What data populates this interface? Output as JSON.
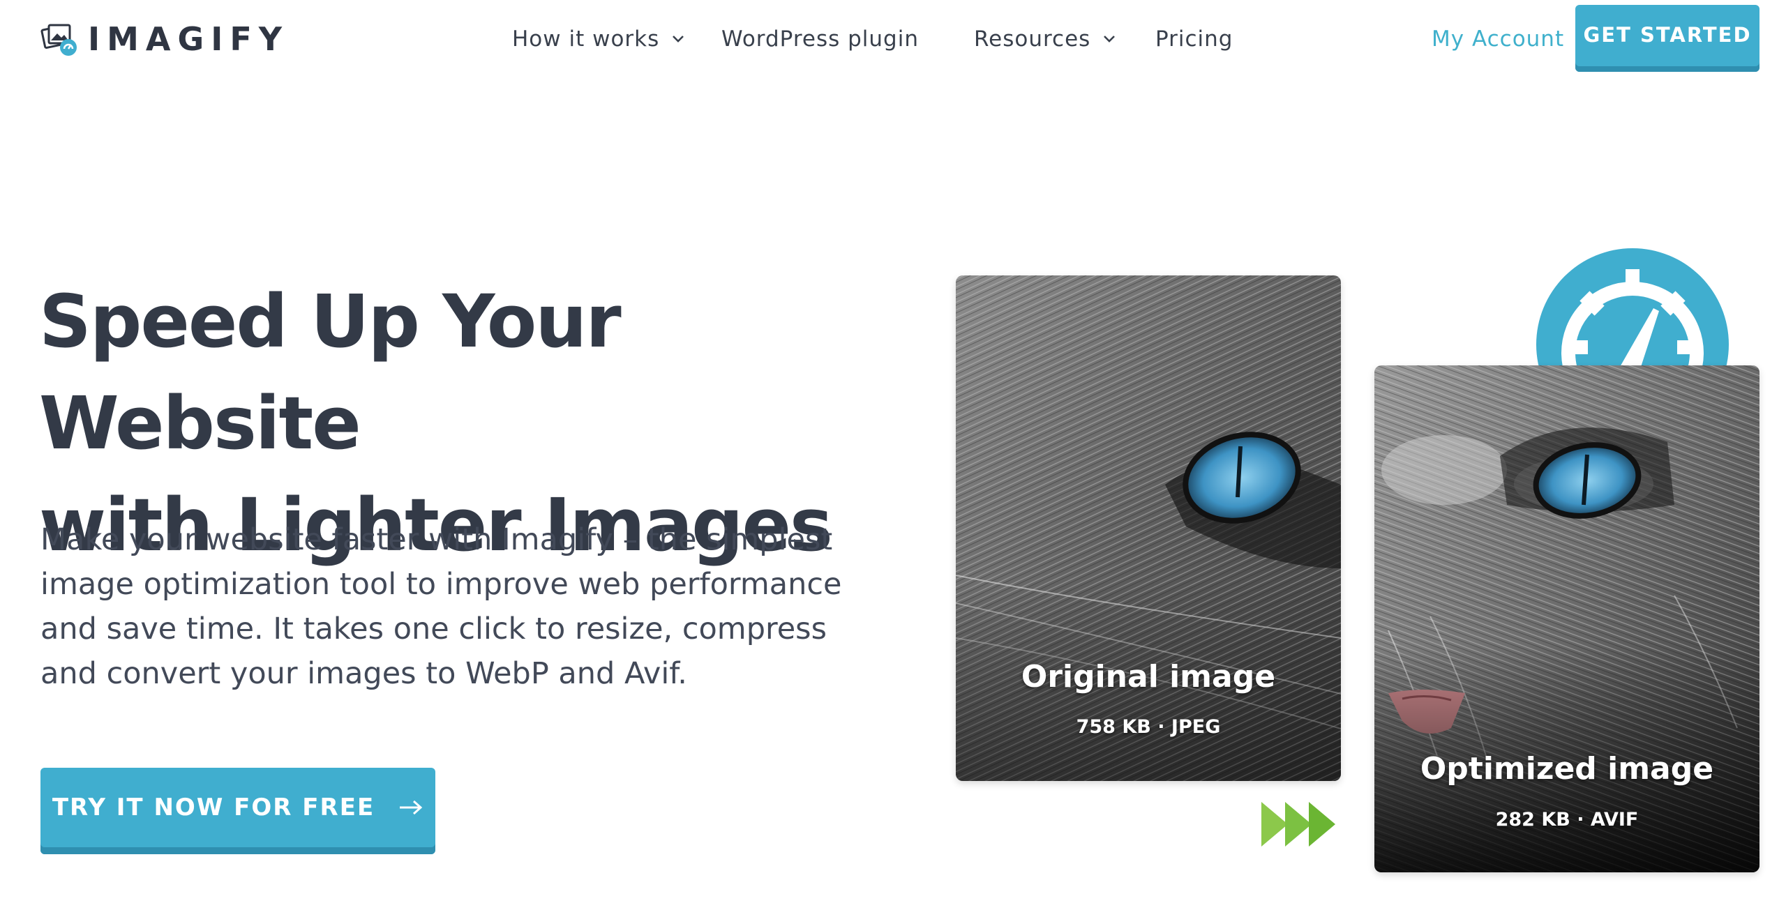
{
  "header": {
    "logo_text": "IMAGIFY",
    "nav": [
      {
        "label": "How it works",
        "has_dropdown": true
      },
      {
        "label": "WordPress plugin",
        "has_dropdown": false
      },
      {
        "label": "Resources",
        "has_dropdown": true
      },
      {
        "label": "Pricing",
        "has_dropdown": false
      }
    ],
    "my_account": "My Account",
    "cta": "GET STARTED"
  },
  "hero": {
    "title_line1": "Speed Up Your Website",
    "title_line2": "with Lighter Images",
    "description": "Make your website faster with Imagify – the simplest image optimization tool to improve web performance and save time. It takes one click to resize, compress and convert your images to WebP and Avif.",
    "cta": "TRY IT NOW FOR FREE"
  },
  "comparison": {
    "original": {
      "title": "Original image",
      "meta": "758 KB · JPEG"
    },
    "optimized": {
      "title": "Optimized image",
      "meta": "282 KB · AVIF"
    }
  },
  "colors": {
    "accent": "#40aecf",
    "text_dark": "#333a47",
    "arrows_green": "#7cc142"
  },
  "icons": [
    "logo-mark-icon",
    "chevron-down-icon",
    "arrow-right-icon",
    "speedometer-icon",
    "forward-arrows-icon"
  ]
}
